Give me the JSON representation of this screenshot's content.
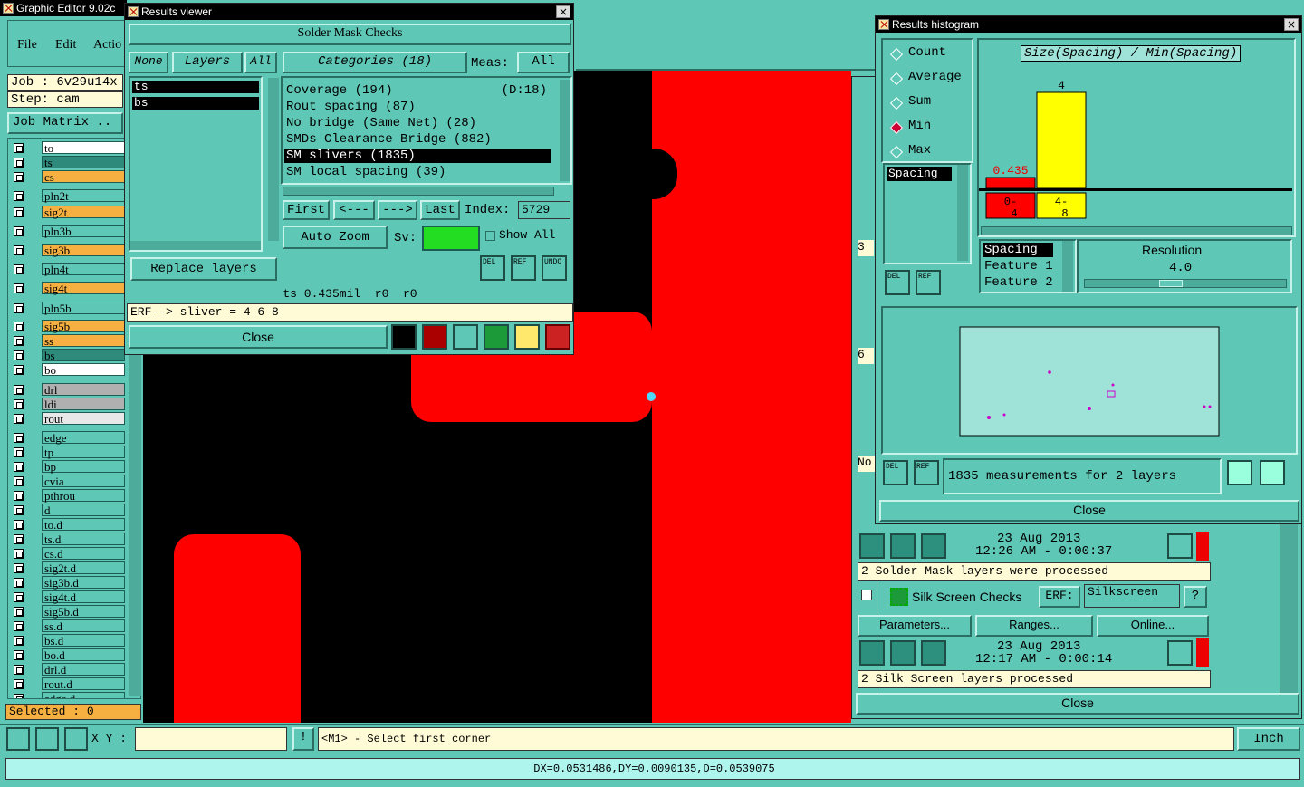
{
  "editor": {
    "title": "Graphic Editor 9.02c",
    "menu": [
      "File",
      "Edit",
      "Actio"
    ],
    "job_label": "Job : 6v29u14x",
    "step_label": "Step: cam",
    "job_matrix": "Job Matrix ..",
    "selected": "Selected : 0",
    "xy_label": "X Y :",
    "xy_value": "",
    "prompt": "<M1> - Select first corner",
    "units": "Inch",
    "status": "DX=0.0531486,DY=0.0090135,D=0.0539075",
    "layers": [
      {
        "name": "to",
        "color": "#ffffff"
      },
      {
        "name": "ts",
        "color": "#2e8b7c"
      },
      {
        "name": "cs",
        "color": "#f5b041"
      },
      {
        "name": "pln2t",
        "color": "#5fc7b6"
      },
      {
        "name": "sig2t",
        "color": "#f5b041"
      },
      {
        "name": "pln3b",
        "color": "#5fc7b6"
      },
      {
        "name": "sig3b",
        "color": "#f5b041"
      },
      {
        "name": "pln4t",
        "color": "#5fc7b6"
      },
      {
        "name": "sig4t",
        "color": "#f5b041"
      },
      {
        "name": "pln5b",
        "color": "#5fc7b6"
      },
      {
        "name": "sig5b",
        "color": "#f5b041"
      },
      {
        "name": "ss",
        "color": "#f5b041"
      },
      {
        "name": "bs",
        "color": "#2e8b7c"
      },
      {
        "name": "bo",
        "color": "#ffffff"
      },
      {
        "name": "drl",
        "color": "#b0b0b0"
      },
      {
        "name": "ldi",
        "color": "#b0b0b0"
      },
      {
        "name": "rout",
        "color": "#e8e8e8"
      },
      {
        "name": "edge",
        "color": "#5fc7b6"
      },
      {
        "name": "tp",
        "color": "#5fc7b6"
      },
      {
        "name": "bp",
        "color": "#5fc7b6"
      },
      {
        "name": "cvia",
        "color": "#5fc7b6"
      },
      {
        "name": "pthrou",
        "color": "#5fc7b6"
      },
      {
        "name": "d",
        "color": "#5fc7b6"
      },
      {
        "name": "to.d",
        "color": "#5fc7b6"
      },
      {
        "name": "ts.d",
        "color": "#5fc7b6"
      },
      {
        "name": "cs.d",
        "color": "#5fc7b6"
      },
      {
        "name": "sig2t.d",
        "color": "#5fc7b6"
      },
      {
        "name": "sig3b.d",
        "color": "#5fc7b6"
      },
      {
        "name": "sig4t.d",
        "color": "#5fc7b6"
      },
      {
        "name": "sig5b.d",
        "color": "#5fc7b6"
      },
      {
        "name": "ss.d",
        "color": "#5fc7b6"
      },
      {
        "name": "bs.d",
        "color": "#5fc7b6"
      },
      {
        "name": "bo.d",
        "color": "#5fc7b6"
      },
      {
        "name": "drl.d",
        "color": "#5fc7b6"
      },
      {
        "name": "rout.d",
        "color": "#5fc7b6"
      },
      {
        "name": "edge.d",
        "color": "#5fc7b6"
      }
    ]
  },
  "results_viewer": {
    "title": "Results viewer",
    "header": "Solder Mask Checks",
    "none_label": "None",
    "layers_label": "Layers",
    "all_label": "All",
    "categories_label": "Categories (18)",
    "meas_label": "Meas:",
    "meas_value": "All",
    "layer_items": [
      "ts",
      "bs"
    ],
    "category_items": [
      {
        "label": "Coverage (194)",
        "extra": "(D:18)"
      },
      {
        "label": "Rout spacing (87)",
        "extra": ""
      },
      {
        "label": "No bridge (Same Net) (28)",
        "extra": ""
      },
      {
        "label": "SMDs Clearance Bridge (882)",
        "extra": ""
      },
      {
        "label": "SM slivers (1835)",
        "extra": ""
      },
      {
        "label": "SM local spacing (39)",
        "extra": ""
      }
    ],
    "first": "First",
    "prev": "<---",
    "next": "--->",
    "last": "Last",
    "index_label": "Index:",
    "index_value": "5729",
    "auto_zoom": "Auto Zoom",
    "sv_label": "Sv:",
    "show_all": "Show All",
    "replace_layers": "Replace layers",
    "del": "DEL",
    "ref": "REF",
    "undo": "UNDO",
    "info": "ts 0.435mil  r0  r0",
    "erf": "ERF--> sliver = 4 6 8",
    "close": "Close"
  },
  "histogram": {
    "title": "Results histogram",
    "modes": [
      "Count",
      "Average",
      "Sum",
      "Min",
      "Max"
    ],
    "selected_mode": "Min",
    "list_item": "Spacing",
    "chart_title": "Size(Spacing) / Min(Spacing)",
    "axis_labels": [
      "Spacing",
      "Feature 1",
      "Feature 2"
    ],
    "resolution_label": "Resolution",
    "resolution_value": "4.0",
    "measurements": "1835 measurements for 2 layers",
    "close": "Close",
    "del": "DEL",
    "ref": "REF"
  },
  "chart_data": {
    "type": "bar",
    "title": "Size(Spacing) / Min(Spacing)",
    "categories": [
      "0-4",
      "4-8"
    ],
    "values": [
      0.435,
      4
    ],
    "value_labels": [
      "0.435",
      "4"
    ],
    "colors": [
      "#ff0000",
      "#ffff00"
    ]
  },
  "side_panel": {
    "row_labels": [
      "3",
      "6",
      "No"
    ],
    "date1": "23 Aug 2013",
    "time1": "12:26 AM - 0:00:37",
    "msg1": "2 Solder Mask layers were processed",
    "check_name": "Silk Screen Checks",
    "erf_label": "ERF:",
    "erf_value": "Silkscreen",
    "help": "?",
    "parameters": "Parameters...",
    "ranges": "Ranges...",
    "online": "Online...",
    "date2": "23 Aug 2013",
    "time2": "12:17 AM - 0:00:14",
    "msg2": "2 Silk Screen layers processed",
    "close": "Close"
  }
}
